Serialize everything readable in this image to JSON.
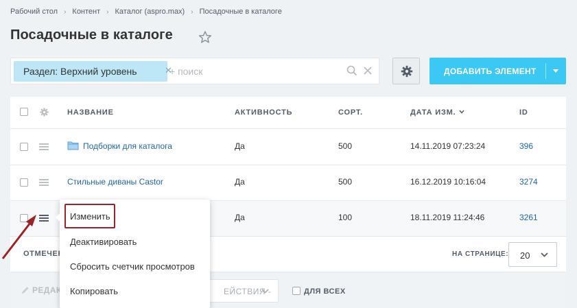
{
  "breadcrumb": [
    "Рабочий стол",
    "Контент",
    "Каталог (aspro.max)",
    "Посадочные в каталоге"
  ],
  "page_title": "Посадочные в каталоге",
  "filter": {
    "chip_label": "Раздел: Верхний уровень",
    "search_placeholder": "+ поиск"
  },
  "add_button": {
    "label": "ДОБАВИТЬ ЭЛЕМЕНТ"
  },
  "table": {
    "columns": [
      "НАЗВАНИЕ",
      "АКТИВНОСТЬ",
      "СОРТ.",
      "ДАТА ИЗМ.",
      "ID"
    ],
    "rows": [
      {
        "name": "Подборки для каталога",
        "active": "Да",
        "sort": "500",
        "date": "14.11.2019 07:23:24",
        "id": "396"
      },
      {
        "name": "Стильные диваны Castor",
        "active": "Да",
        "sort": "500",
        "date": "16.12.2019 10:16:04",
        "id": "3274"
      },
      {
        "name": "",
        "active": "Да",
        "sort": "100",
        "date": "18.11.2019 11:24:46",
        "id": "3261"
      }
    ]
  },
  "footer": {
    "marked_label": "ОТМЕЧЕН",
    "per_page_label": "НА СТРАНИЦЕ:",
    "per_page_value": "20"
  },
  "action_bar": {
    "edit_label": "РЕДАК",
    "actions_label": "ЕЙСТВИЯ -",
    "for_all_label": "ДЛЯ ВСЕХ"
  },
  "context_menu": {
    "items": [
      "Изменить",
      "Деактивировать",
      "Сбросить счетчик просмотров",
      "Копировать"
    ]
  },
  "colors": {
    "accent": "#3bc8f5",
    "chip": "#bde6f6",
    "link": "#2067b0",
    "highlight_border": "#9b2226"
  }
}
